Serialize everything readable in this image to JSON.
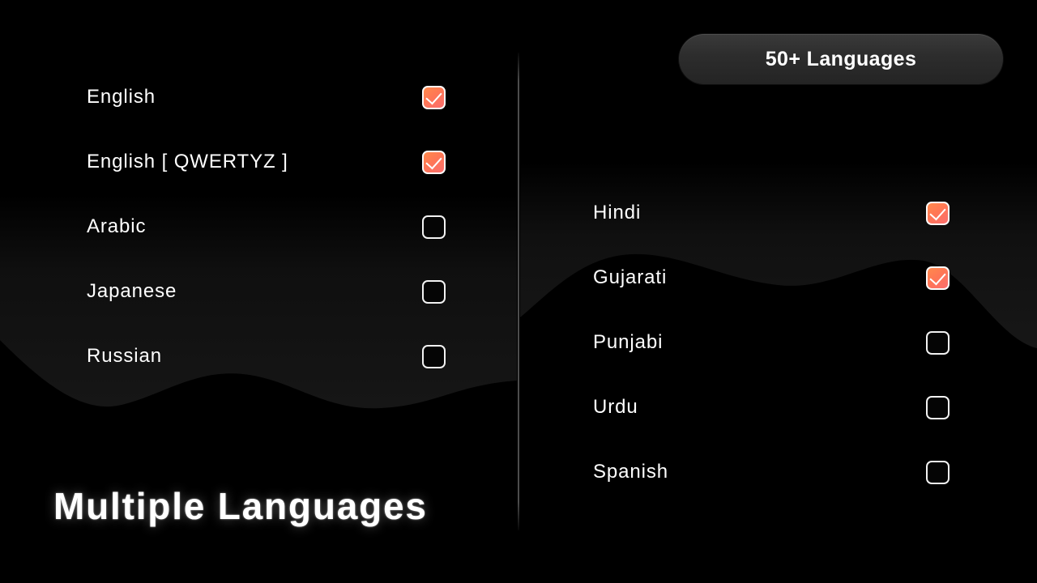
{
  "badge": {
    "label": "50+ Languages"
  },
  "title": "Multiple Languages",
  "columns": {
    "left": [
      {
        "name": "English",
        "checked": true,
        "state": "checked"
      },
      {
        "name": "English [ QWERTYZ ]",
        "checked": true,
        "state": "checked"
      },
      {
        "name": "Arabic",
        "checked": false,
        "state": "unchecked"
      },
      {
        "name": "Japanese",
        "checked": false,
        "state": "unchecked"
      },
      {
        "name": "Russian",
        "checked": false,
        "state": "unchecked"
      }
    ],
    "right": [
      {
        "name": "Hindi",
        "checked": true,
        "state": "checked"
      },
      {
        "name": "Gujarati",
        "checked": true,
        "state": "checked"
      },
      {
        "name": "Punjabi",
        "checked": false,
        "state": "unchecked"
      },
      {
        "name": "Urdu",
        "checked": false,
        "state": "unchecked"
      },
      {
        "name": "Spanish",
        "checked": false,
        "state": "unchecked"
      }
    ]
  },
  "colors": {
    "background": "#000000",
    "accent_start": "#ff8a4c",
    "accent_end": "#fb6e6e",
    "badge_fill": "#2d2d2d",
    "text": "#ffffff",
    "divider": "#3a3a3a",
    "wave_fill": "#121212"
  },
  "icons": {
    "check": "check-icon",
    "divider": "vertical-divider"
  }
}
